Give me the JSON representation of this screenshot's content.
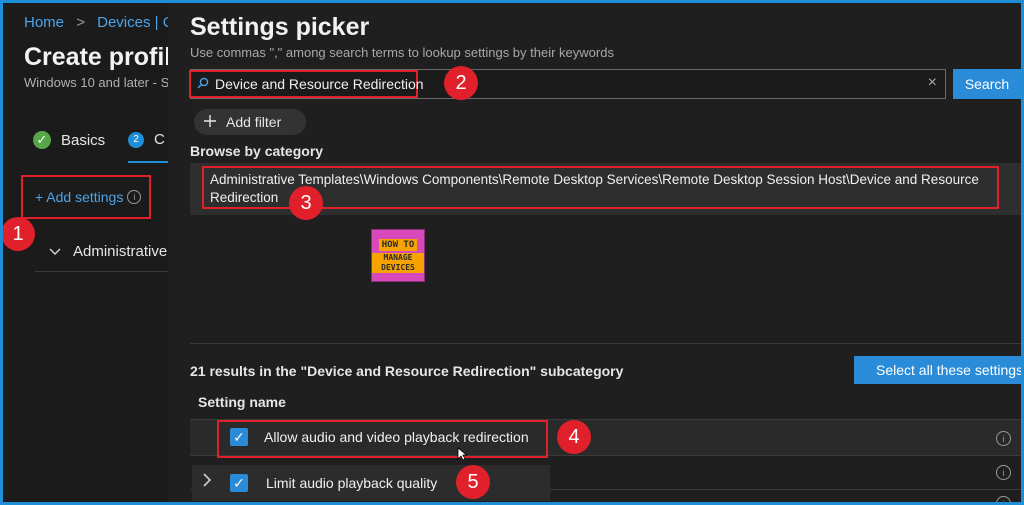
{
  "breadcrumb": {
    "home": "Home",
    "sep": ">",
    "devices": "Devices | Co"
  },
  "page": {
    "title": "Create profil",
    "subtitle": "Windows 10 and later - S"
  },
  "steps": {
    "basics_label": "Basics",
    "config_num": "2",
    "config_label": "C"
  },
  "add_settings": {
    "label": "+ Add settings",
    "info": "i"
  },
  "left_section": {
    "label": "Administrative"
  },
  "picker": {
    "title": "Settings picker",
    "hint": "Use commas \",\" among search terms to lookup settings by their keywords",
    "search_value": "Device and Resource Redirection",
    "clear": "×",
    "search_button": "Search",
    "add_filter": "Add filter",
    "browse_heading": "Browse by category",
    "category_path": "Administrative Templates\\Windows Components\\Remote Desktop Services\\Remote Desktop Session Host\\Device and Resource Redirection",
    "results_text": "21 results in the \"Device and Resource Redirection\" subcategory",
    "select_all": "Select all these settings",
    "column_header": "Setting name",
    "settings": [
      {
        "label": "Allow audio and video playback redirection",
        "checked": true
      },
      {
        "label": "Limit audio playback quality",
        "checked": true
      }
    ]
  },
  "logo": {
    "top": "HOW TO",
    "bottom": "MANAGE DEVICES"
  },
  "markers": [
    "1",
    "2",
    "3",
    "4",
    "5"
  ],
  "colors": {
    "accent": "#2a8cd8",
    "highlight": "#e0202a",
    "success": "#57a64a"
  }
}
